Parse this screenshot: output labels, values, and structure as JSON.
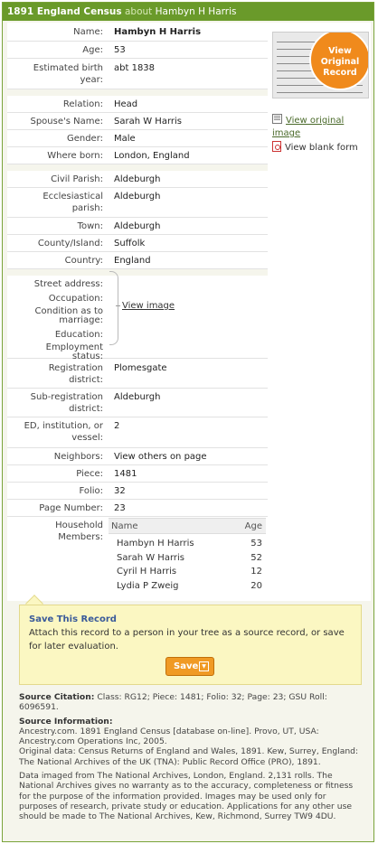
{
  "header": {
    "census": "1891 England Census",
    "about": "about",
    "name": "Hambyn H Harris"
  },
  "fields": {
    "name": {
      "label": "Name:",
      "value": "Hambyn H Harris"
    },
    "age": {
      "label": "Age:",
      "value": "53"
    },
    "birth": {
      "label1": "Estimated birth",
      "label2": "year:",
      "value": "abt 1838"
    },
    "relation": {
      "label": "Relation:",
      "value": "Head"
    },
    "spouse": {
      "label": "Spouse's Name:",
      "value": "Sarah W Harris"
    },
    "gender": {
      "label": "Gender:",
      "value": "Male"
    },
    "born": {
      "label": "Where born:",
      "value": "London, England"
    },
    "civil": {
      "label": "Civil Parish:",
      "value": "Aldeburgh"
    },
    "eccl": {
      "label1": "Ecclesiastical",
      "label2": "parish:",
      "value": "Aldeburgh"
    },
    "town": {
      "label": "Town:",
      "value": "Aldeburgh"
    },
    "county": {
      "label": "County/Island:",
      "value": "Suffolk"
    },
    "country": {
      "label": "Country:",
      "value": "England"
    },
    "street": {
      "label": "Street address:"
    },
    "occupation": {
      "label": "Occupation:"
    },
    "condition": {
      "label1": "Condition as to",
      "label2": "marriage:"
    },
    "education": {
      "label": "Education:"
    },
    "employment": {
      "label1": "Employment",
      "label2": "status:"
    },
    "view_image": "View image",
    "reg": {
      "label1": "Registration",
      "label2": "district:",
      "value": "Plomesgate"
    },
    "subreg": {
      "label1": "Sub-registration",
      "label2": "district:",
      "value": "Aldeburgh"
    },
    "ed": {
      "label1": "ED, institution, or",
      "label2": "vessel:",
      "value": "2"
    },
    "neighbors": {
      "label": "Neighbors:",
      "value": "View others on page"
    },
    "piece": {
      "label": "Piece:",
      "value": "1481"
    },
    "folio": {
      "label": "Folio:",
      "value": "32"
    },
    "page": {
      "label": "Page Number:",
      "value": "23"
    }
  },
  "household": {
    "label1": "Household",
    "label2": "Members:",
    "col_name": "Name",
    "col_age": "Age",
    "members": [
      {
        "name": "Hambyn H Harris",
        "age": "53"
      },
      {
        "name": "Sarah W Harris",
        "age": "52"
      },
      {
        "name": "Cyril H Harris",
        "age": "12"
      },
      {
        "name": "Lydia P Zweig",
        "age": "20"
      }
    ]
  },
  "side": {
    "seal": [
      "View",
      "Original",
      "Record"
    ],
    "view_original": "View original image",
    "view_blank": "View blank form"
  },
  "save": {
    "title": "Save This Record",
    "desc": "Attach this record to a person in your tree as a source record, or save for later evaluation.",
    "button": "Save"
  },
  "source": {
    "citation_label": "Source Citation:",
    "citation": "Class: RG12; Piece: 1481; Folio: 32; Page: 23; GSU Roll: 6096591.",
    "info_label": "Source Information:",
    "info": "Ancestry.com. 1891 England Census [database on-line]. Provo, UT, USA: Ancestry.com Operations Inc, 2005.",
    "original": "Original data: Census Returns of England and Wales, 1891. Kew, Surrey, England: The National Archives of the UK (TNA): Public Record Office (PRO), 1891.",
    "imaged": "Data imaged from The National Archives, London, England. 2,131 rolls. The National Archives gives no warranty as to the accuracy, completeness or fitness for the purpose of the information provided. Images may be used only for purposes of research, private study or education. Applications for any other use should be made to The National Archives, Kew, Richmond, Surrey TW9 4DU."
  },
  "colors": {
    "header": "#6a9a2a",
    "accent": "#f09a24",
    "savebox": "#fbf7c2",
    "link": "#3a5a9a"
  }
}
